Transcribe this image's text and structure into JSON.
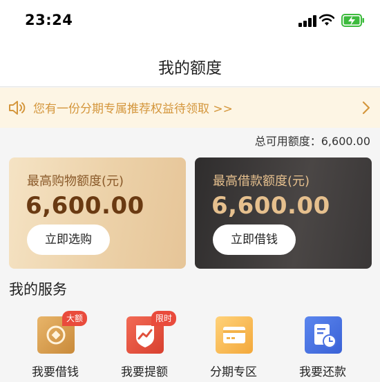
{
  "status_bar": {
    "time": "23:24"
  },
  "nav": {
    "title": "我的额度"
  },
  "promo": {
    "text": "您有一份分期专属推荐权益待领取 >>"
  },
  "total_quota": {
    "label": "总可用额度：",
    "value": "6,600.00"
  },
  "cards": {
    "shopping": {
      "label": "最高购物额度(元)",
      "amount": "6,600.00",
      "button": "立即选购"
    },
    "loan": {
      "label": "最高借款额度(元)",
      "amount": "6,600.00",
      "button": "立即借钱"
    }
  },
  "services": {
    "title": "我的服务",
    "items": [
      {
        "label": "我要借钱",
        "badge": "大额",
        "icon": "coin-icon"
      },
      {
        "label": "我要提额",
        "badge": "限时",
        "icon": "trend-shield-icon"
      },
      {
        "label": "分期专区",
        "icon": "card-icon"
      },
      {
        "label": "我要还款",
        "icon": "bill-clock-icon"
      }
    ]
  },
  "colors": {
    "promo_text": "#d4963c",
    "badge": "#e94b3c",
    "gold": "#e6c08e"
  }
}
